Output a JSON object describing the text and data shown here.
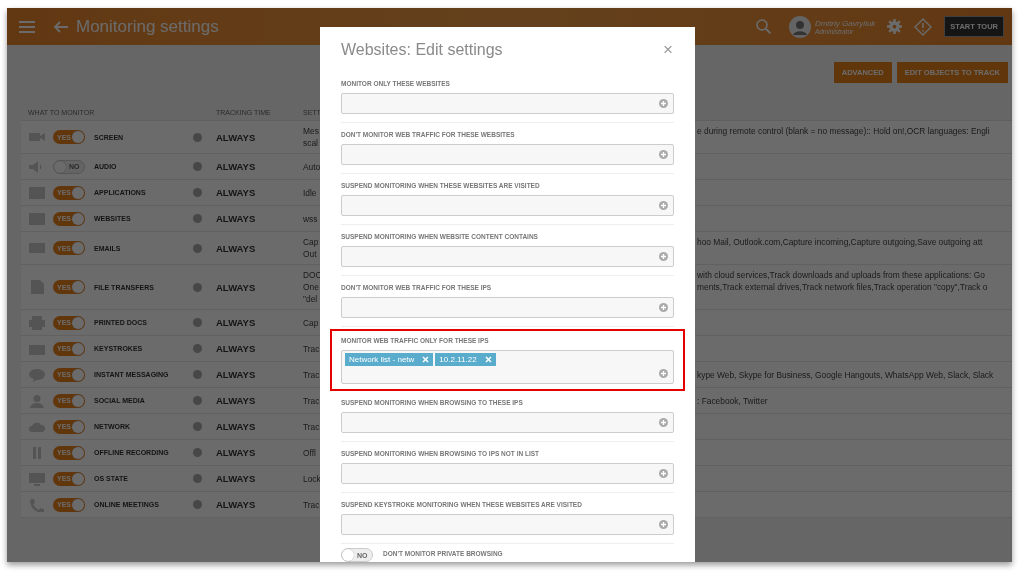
{
  "header": {
    "title": "Monitoring settings",
    "user": {
      "name": "Dmitriy Gavryliuk",
      "role": "Administrator"
    },
    "tour_button": "START TOUR"
  },
  "toolbar": {
    "buttons": [
      "ADVANCED",
      "EDIT OBJECTS TO TRACK"
    ]
  },
  "table": {
    "columns": [
      "WHAT TO MONITOR",
      "TRACKING TIME",
      "SETT"
    ],
    "rows": [
      {
        "name": "SCREEN",
        "toggle": {
          "on": true,
          "text": "YES"
        },
        "time": "ALWAYS",
        "settings_left": [
          "Mes",
          "scal"
        ],
        "settings_right": [
          "e during remote control (blank = no message):: Hold on!,OCR languages: Engli"
        ]
      },
      {
        "name": "AUDIO",
        "toggle": {
          "on": false,
          "text": "NO"
        },
        "time": "ALWAYS",
        "settings_left": [
          "Auto"
        ],
        "settings_right": []
      },
      {
        "name": "APPLICATIONS",
        "toggle": {
          "on": true,
          "text": "YES"
        },
        "time": "ALWAYS",
        "settings_left": [
          "Idle"
        ],
        "settings_right": []
      },
      {
        "name": "WEBSITES",
        "toggle": {
          "on": true,
          "text": "YES"
        },
        "time": "ALWAYS",
        "settings_left": [
          "wss"
        ],
        "settings_right": []
      },
      {
        "name": "EMAILS",
        "toggle": {
          "on": true,
          "text": "YES"
        },
        "time": "ALWAYS",
        "settings_left": [
          "Cap",
          "Out"
        ],
        "settings_right": [
          "hoo Mail, Outlook.com,Capture incoming,Capture outgoing,Save outgoing att"
        ]
      },
      {
        "name": "FILE TRANSFERS",
        "toggle": {
          "on": true,
          "text": "YES"
        },
        "time": "ALWAYS",
        "settings_left": [
          "DOO",
          "One",
          "\"del"
        ],
        "settings_right": [
          "with cloud services,Track downloads and uploads from these applications: Go",
          "ments,Track external drives,Track network files,Track operation \"copy\",Track o"
        ]
      },
      {
        "name": "PRINTED DOCS",
        "toggle": {
          "on": true,
          "text": "YES"
        },
        "time": "ALWAYS",
        "settings_left": [
          "Cap"
        ],
        "settings_right": []
      },
      {
        "name": "KEYSTROKES",
        "toggle": {
          "on": true,
          "text": "YES"
        },
        "time": "ALWAYS",
        "settings_left": [
          "Trac"
        ],
        "settings_right": []
      },
      {
        "name": "INSTANT MESSAGING",
        "toggle": {
          "on": true,
          "text": "YES"
        },
        "time": "ALWAYS",
        "settings_left": [
          "Trac"
        ],
        "settings_right": [
          "kype Web, Skype for Business, Google Hangouts, WhatsApp Web, Slack, Slack"
        ]
      },
      {
        "name": "SOCIAL MEDIA",
        "toggle": {
          "on": true,
          "text": "YES"
        },
        "time": "ALWAYS",
        "settings_left": [
          "Trac"
        ],
        "settings_right": [
          ": Facebook, Twitter"
        ]
      },
      {
        "name": "NETWORK",
        "toggle": {
          "on": true,
          "text": "YES"
        },
        "time": "ALWAYS",
        "settings_left": [
          "Trac"
        ],
        "settings_right": []
      },
      {
        "name": "OFFLINE RECORDING",
        "toggle": {
          "on": true,
          "text": "YES"
        },
        "time": "ALWAYS",
        "settings_left": [
          "Offl"
        ],
        "settings_right": []
      },
      {
        "name": "OS STATE",
        "toggle": {
          "on": true,
          "text": "YES"
        },
        "time": "ALWAYS",
        "settings_left": [
          "Lock"
        ],
        "settings_right": []
      },
      {
        "name": "ONLINE MEETINGS",
        "toggle": {
          "on": true,
          "text": "YES"
        },
        "time": "ALWAYS",
        "settings_left": [
          "Trac"
        ],
        "settings_right": []
      }
    ]
  },
  "modal": {
    "title": "Websites: Edit settings",
    "close": "×",
    "sections": [
      {
        "label": "MONITOR ONLY THESE WEBSITES",
        "highlighted": false
      },
      {
        "label": "DON'T MONITOR WEB TRAFFIC FOR THESE WEBSITES",
        "highlighted": false
      },
      {
        "label": "SUSPEND MONITORING WHEN THESE WEBSITES ARE VISITED",
        "highlighted": false
      },
      {
        "label": "SUSPEND MONITORING WHEN WEBSITE CONTENT CONTAINS",
        "highlighted": false
      },
      {
        "label": "DON'T MONITOR WEB TRAFFIC FOR THESE IPS",
        "highlighted": false
      },
      {
        "label": "MONITOR WEB TRAFFIC ONLY FOR THESE IPS",
        "highlighted": true,
        "chips": [
          "Network list - netw",
          "10.2.11.22"
        ]
      },
      {
        "label": "SUSPEND MONITORING WHEN BROWSING TO THESE IPS",
        "highlighted": false
      },
      {
        "label": "SUSPEND MONITORING WHEN BROWSING TO IPS NOT IN LIST",
        "highlighted": false
      },
      {
        "label": "SUSPEND KEYSTROKE MONITORING WHEN THESE WEBSITES ARE VISITED",
        "highlighted": false
      }
    ],
    "private_browsing": {
      "label": "DON'T MONITOR PRIVATE BROWSING",
      "on": false,
      "text": "NO"
    }
  }
}
